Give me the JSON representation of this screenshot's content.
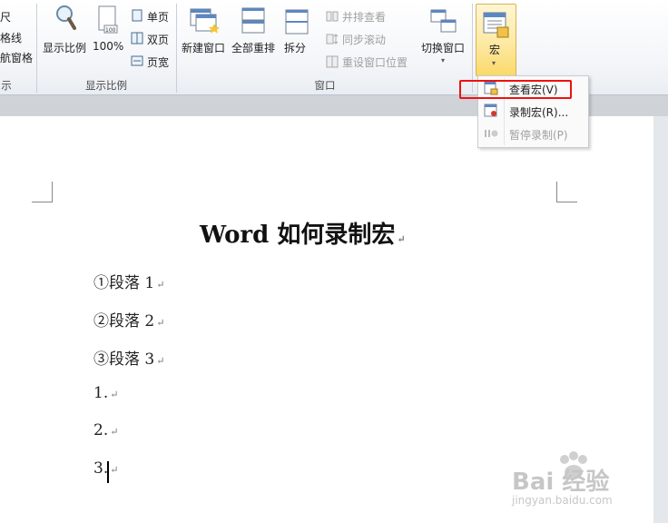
{
  "ribbon": {
    "partial_left": {
      "item1": "尺",
      "item2": "格线",
      "item3": "航窗格",
      "group_label": "示"
    },
    "zoom_group": {
      "zoom_label": "显示比例",
      "hundred_label": "100%",
      "single_page": "单页",
      "two_page": "双页",
      "page_width": "页宽",
      "group_label": "显示比例"
    },
    "window_group": {
      "new_window": "新建窗口",
      "arrange_all": "全部重排",
      "split": "拆分",
      "view_side_by_side": "并排查看",
      "sync_scroll": "同步滚动",
      "reset_position": "重设窗口位置",
      "switch_windows": "切换窗口",
      "group_label": "窗口"
    },
    "macros_group": {
      "macros_label": "宏"
    }
  },
  "macro_menu": {
    "items": [
      {
        "label": "查看宏(V)",
        "enabled": true
      },
      {
        "label": "录制宏(R)...",
        "enabled": true
      },
      {
        "label": "暂停录制(P)",
        "enabled": false
      }
    ]
  },
  "document": {
    "title": "Word 如何录制宏",
    "paragraphs": [
      "①段落 1",
      "②段落 2",
      "③段落 3",
      "1.",
      "2.",
      "3."
    ],
    "pilcrow": "↵"
  },
  "watermark": {
    "brand": "Bai 经验",
    "url": "jingyan.baidu.com"
  },
  "colors": {
    "highlight": "#e11111",
    "ribbon_bg": "#f3f5f8",
    "active_tab": "#fde9a4"
  }
}
